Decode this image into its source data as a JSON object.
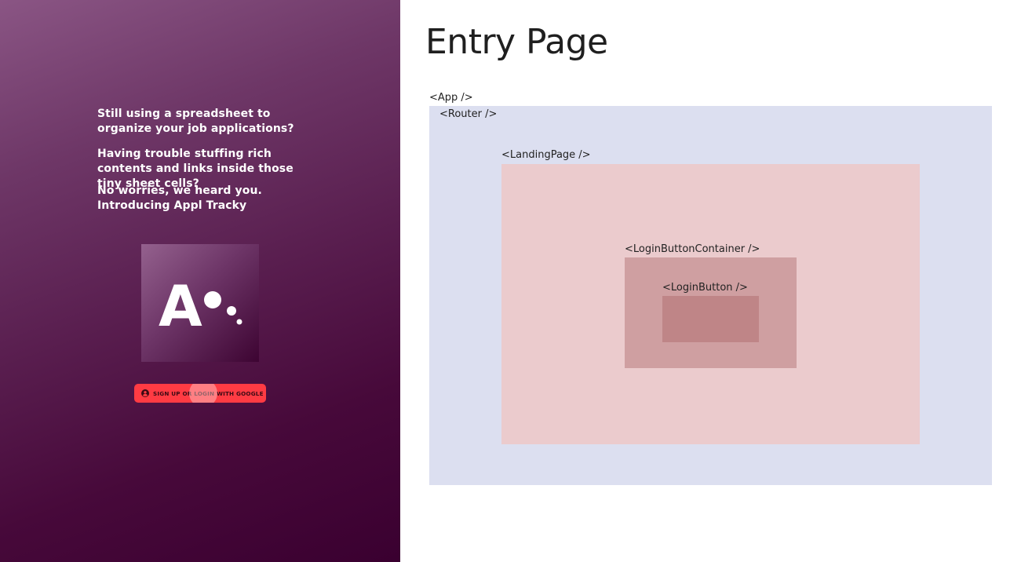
{
  "landing": {
    "pitch": [
      "Still using a spreadsheet to organize your job applications?",
      "Having trouble stuffing rich contents and links inside those tiny sheet cells?",
      "No worries, we heard you. Introducing Appl Tracky"
    ],
    "logo_text": "A",
    "login_button_label": "SIGN UP OR LOGIN WITH GOOGLE",
    "login_icon": "account-circle-icon"
  },
  "diagram": {
    "title": "Entry Page",
    "components": {
      "app": "<App />",
      "router": "<Router />",
      "landing_page": "<LandingPage />",
      "login_button_container": "<LoginButtonContainer />",
      "login_button": "<LoginButton />"
    },
    "colors": {
      "app": "#dcdff0",
      "landing_page": "#ebcbcd",
      "login_button_container": "#cf9fa1",
      "login_button": "#bf8587"
    }
  }
}
